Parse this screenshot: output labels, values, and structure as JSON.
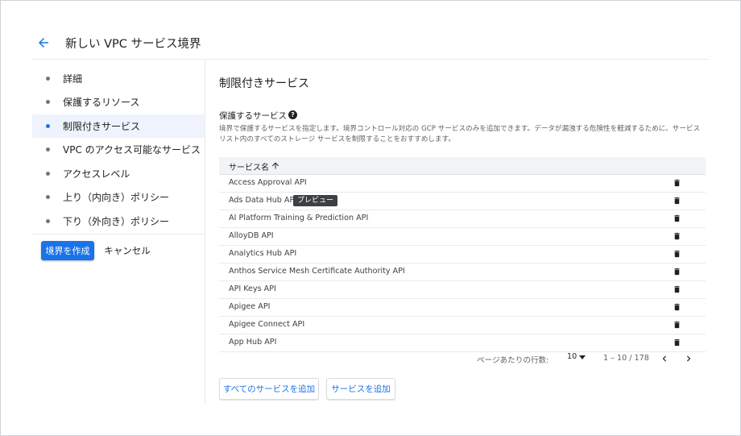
{
  "header": {
    "title": "新しい VPC サービス境界",
    "back_icon": "arrow-back-icon"
  },
  "colors": {
    "accent": "#1a73e8",
    "active_nav_bg": "#eef3fd",
    "badge_bg": "#3c4043"
  },
  "sidebar": {
    "items": [
      {
        "label": "詳細"
      },
      {
        "label": "保護するリソース"
      },
      {
        "label": "制限付きサービス",
        "active": true
      },
      {
        "label": "VPC のアクセス可能なサービス"
      },
      {
        "label": "アクセスレベル"
      },
      {
        "label": "上り（内向き）ポリシー"
      },
      {
        "label": "下り（外向き）ポリシー"
      }
    ],
    "create_label": "境界を作成",
    "cancel_label": "キャンセル"
  },
  "main": {
    "section_title": "制限付きサービス",
    "subsection_title": "保護するサービス",
    "help_icon": "help-icon",
    "description": "境界で保護するサービスを指定します。境界コントロール対応の GCP サービスのみを追加できます。データが漏洩する危険性を軽減するために、サービスリスト内のすべてのストレージ サービスを制限することをおすすめします。",
    "table": {
      "column_header": "サービス名",
      "sort_icon": "arrow-up-icon",
      "delete_icon": "trash-icon",
      "rows": [
        {
          "name": "Access Approval API"
        },
        {
          "name": "Ads Data Hub API",
          "badge": "プレビュー"
        },
        {
          "name": "AI Platform Training & Prediction API"
        },
        {
          "name": "AlloyDB API"
        },
        {
          "name": "Analytics Hub API"
        },
        {
          "name": "Anthos Service Mesh Certificate Authority API"
        },
        {
          "name": "API Keys API"
        },
        {
          "name": "Apigee API"
        },
        {
          "name": "Apigee Connect API"
        },
        {
          "name": "App Hub API"
        }
      ]
    },
    "pagination": {
      "rows_label": "ページあたりの行数:",
      "rows_value": "10",
      "range": "1 – 10 / 178"
    },
    "add_all_label": "すべてのサービスを追加",
    "add_label": "サービスを追加"
  }
}
